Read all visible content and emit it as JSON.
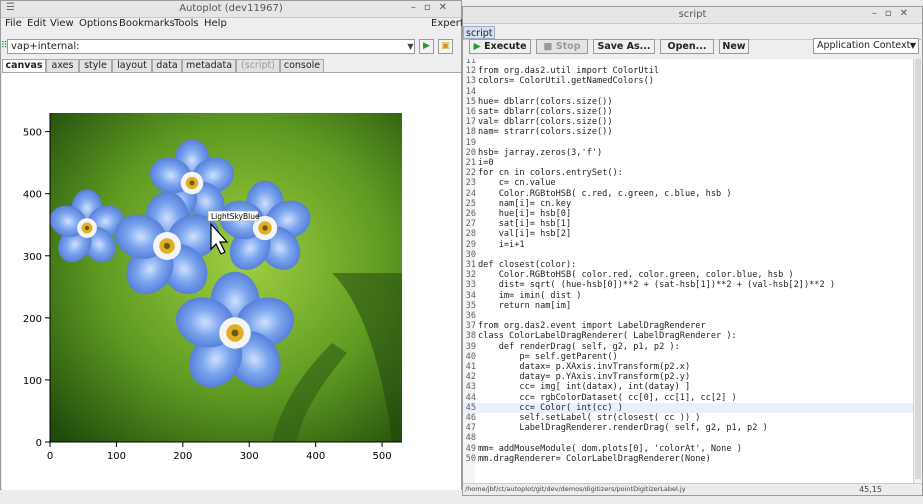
{
  "autoplot": {
    "title": "Autoplot (dev11967)",
    "menus": [
      "File",
      "Edit",
      "View",
      "Options",
      "Bookmarks",
      "Tools",
      "Help"
    ],
    "expert": "Expert",
    "address_value": "vap+internal:",
    "tabs": [
      "canvas",
      "axes",
      "style",
      "layout",
      "data",
      "metadata",
      "(script)",
      "console"
    ],
    "selected_tab": "canvas",
    "plot": {
      "image_subject": "photo of blue forget-me-not flowers on green background",
      "tooltip": "LightSkyBlue",
      "x_ticks": [
        "0",
        "100",
        "200",
        "300",
        "400",
        "500"
      ],
      "y_ticks": [
        "0",
        "100",
        "200",
        "300",
        "400",
        "500"
      ]
    }
  },
  "script": {
    "title": "script",
    "tab": "script",
    "buttons": {
      "execute": "Execute",
      "stop": "Stop",
      "saveas": "Save As...",
      "open": "Open...",
      "new": "New"
    },
    "context": "Application Context",
    "status_path": "/home/jbf/ct/autoplot/git/dev/demos/digitizers/pointDigitizerLabel.jy",
    "cursor_pos": "45,15",
    "lines": [
      {
        "n": "11",
        "t": ""
      },
      {
        "n": "12",
        "t": "from org.das2.util import ColorUtil"
      },
      {
        "n": "13",
        "t": "colors= ColorUtil.getNamedColors()"
      },
      {
        "n": "14",
        "t": ""
      },
      {
        "n": "15",
        "t": "hue= dblarr(colors.size())"
      },
      {
        "n": "16",
        "t": "sat= dblarr(colors.size())"
      },
      {
        "n": "17",
        "t": "val= dblarr(colors.size())"
      },
      {
        "n": "18",
        "t": "nam= strarr(colors.size())"
      },
      {
        "n": "19",
        "t": ""
      },
      {
        "n": "20",
        "t": "hsb= jarray.zeros(3,'f')"
      },
      {
        "n": "21",
        "t": "i=0"
      },
      {
        "n": "22",
        "t": "for cn in colors.entrySet():"
      },
      {
        "n": "23",
        "t": "    c= cn.value"
      },
      {
        "n": "24",
        "t": "    Color.RGBtoHSB( c.red, c.green, c.blue, hsb )"
      },
      {
        "n": "25",
        "t": "    nam[i]= cn.key"
      },
      {
        "n": "26",
        "t": "    hue[i]= hsb[0]"
      },
      {
        "n": "27",
        "t": "    sat[i]= hsb[1]"
      },
      {
        "n": "28",
        "t": "    val[i]= hsb[2]"
      },
      {
        "n": "29",
        "t": "    i=i+1"
      },
      {
        "n": "30",
        "t": ""
      },
      {
        "n": "31",
        "t": "def closest(color):"
      },
      {
        "n": "32",
        "t": "    Color.RGBtoHSB( color.red, color.green, color.blue, hsb )"
      },
      {
        "n": "33",
        "t": "    dist= sqrt( (hue-hsb[0])**2 + (sat-hsb[1])**2 + (val-hsb[2])**2 )"
      },
      {
        "n": "34",
        "t": "    im= imin( dist )"
      },
      {
        "n": "35",
        "t": "    return nam[im]"
      },
      {
        "n": "36",
        "t": ""
      },
      {
        "n": "37",
        "t": "from org.das2.event import LabelDragRenderer"
      },
      {
        "n": "38",
        "t": "class ColorLabelDragRenderer( LabelDragRenderer ):"
      },
      {
        "n": "39",
        "t": "    def renderDrag( self, g2, p1, p2 ):"
      },
      {
        "n": "40",
        "t": "        p= self.getParent()"
      },
      {
        "n": "41",
        "t": "        datax= p.XAxis.invTransform(p2.x)"
      },
      {
        "n": "42",
        "t": "        datay= p.YAxis.invTransform(p2.y)"
      },
      {
        "n": "43",
        "t": "        cc= img[ int(datax), int(datay) ]"
      },
      {
        "n": "44",
        "t": "        cc= rgbColorDataset( cc[0], cc[1], cc[2] )"
      },
      {
        "n": "45",
        "t": "        cc= Color( int(cc) )"
      },
      {
        "n": "46",
        "t": "        self.setLabel( str(closest( cc )) )"
      },
      {
        "n": "47",
        "t": "        LabelDragRenderer.renderDrag( self, g2, p1, p2 )"
      },
      {
        "n": "48",
        "t": ""
      },
      {
        "n": "49",
        "t": "mm= addMouseModule( dom.plots[0], 'colorAt', None )"
      },
      {
        "n": "50",
        "t": "mm.dragRenderer= ColorLabelDragRenderer(None)"
      }
    ],
    "highlight_line": "45"
  },
  "colors": {
    "selected_tab_bg": "#d6e1ee",
    "keyword": "#1c3aa8",
    "play_green": "#2a9a2a"
  }
}
